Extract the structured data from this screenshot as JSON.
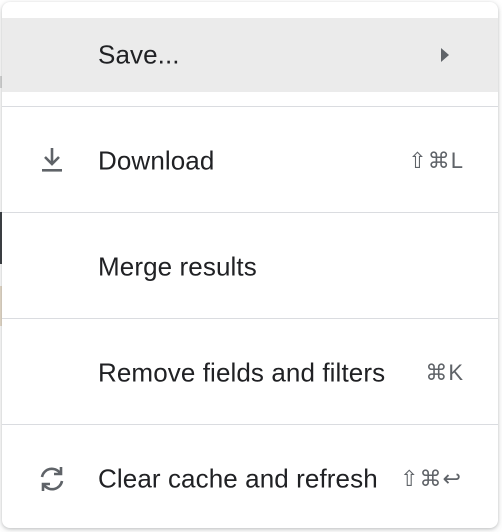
{
  "menu": {
    "items": [
      {
        "label": "Save...",
        "icon": "none",
        "shortcut": "",
        "has_submenu": true,
        "hovered": true
      },
      {
        "label": "Download",
        "icon": "download-icon",
        "shortcut": "⇧⌘L",
        "has_submenu": false,
        "hovered": false
      },
      {
        "label": "Merge results",
        "icon": "none",
        "shortcut": "",
        "has_submenu": false,
        "hovered": false
      },
      {
        "label": "Remove fields and filters",
        "icon": "none",
        "shortcut": "⌘K",
        "has_submenu": false,
        "hovered": false
      },
      {
        "label": "Clear cache and refresh",
        "icon": "refresh-icon",
        "shortcut": "⇧⌘↩",
        "has_submenu": false,
        "hovered": false
      }
    ]
  },
  "colors": {
    "text": "#202124",
    "shortcut": "#5f6368",
    "icon": "#5f6368",
    "divider": "#dadce0",
    "hover_bg": "#ebebeb"
  }
}
